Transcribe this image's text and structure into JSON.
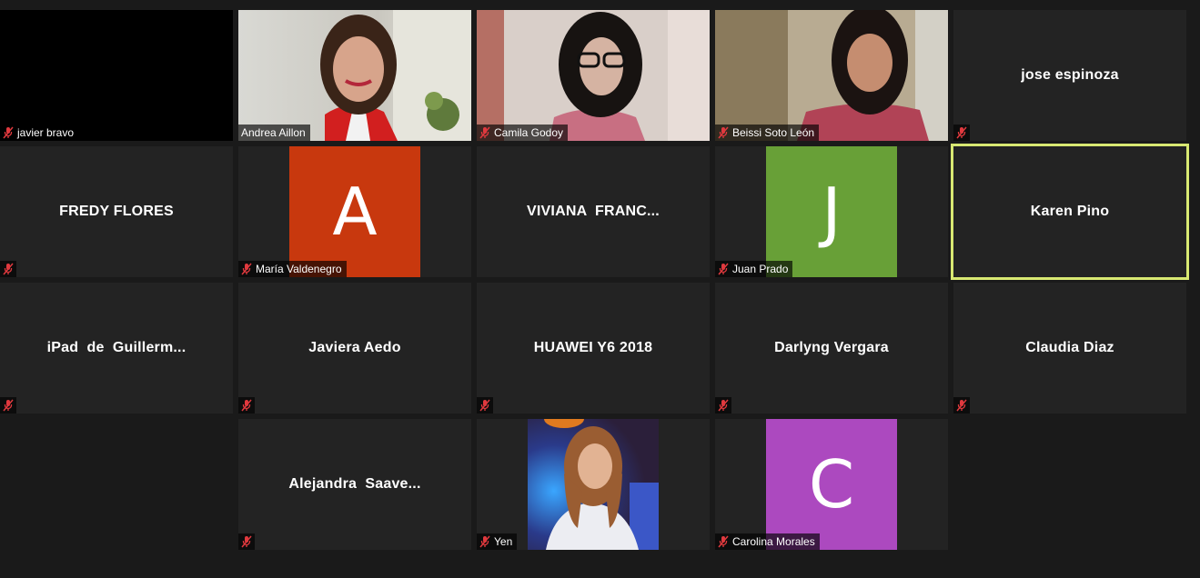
{
  "tiles": {
    "javier": {
      "label": "javier bravo"
    },
    "andrea": {
      "label": "Andrea Aillon"
    },
    "camila": {
      "label": "Camila Godoy"
    },
    "beissi": {
      "label": "Beissi Soto León"
    },
    "jose": {
      "name": "jose espinoza"
    },
    "fredy": {
      "name": "FREDY FLORES"
    },
    "maria": {
      "label": "María Valdenegro",
      "initial": "A",
      "color": "#c8380e"
    },
    "viviana": {
      "name": "VIVIANA  FRANC..."
    },
    "juan": {
      "label": "Juan Prado",
      "initial": "J",
      "color": "#68a037"
    },
    "karen": {
      "name": "Karen Pino"
    },
    "ipad": {
      "name": "iPad  de  Guillerm..."
    },
    "javiera": {
      "name": "Javiera Aedo"
    },
    "huawei": {
      "name": "HUAWEI Y6 2018"
    },
    "darlyng": {
      "name": "Darlyng Vergara"
    },
    "claudia": {
      "name": "Claudia Diaz"
    },
    "alejandra": {
      "name": "Alejandra  Saave..."
    },
    "yen": {
      "label": "Yen"
    },
    "carolina": {
      "label": "Carolina Morales",
      "initial": "C",
      "color": "#ac49bf"
    }
  },
  "colors": {
    "active_border": "#d8e872",
    "mute_icon": "#e0393e"
  },
  "icons": {
    "muted": "mic-muted-icon"
  }
}
